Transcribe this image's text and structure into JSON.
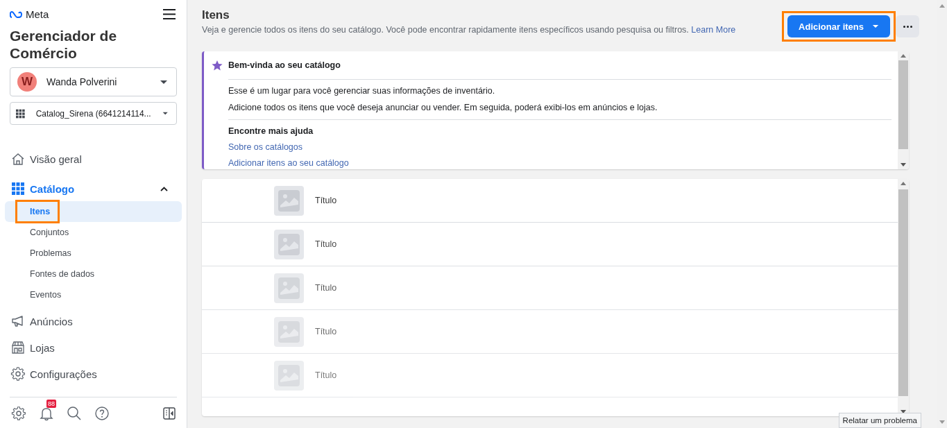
{
  "sidebar": {
    "brand": "Meta",
    "title": "Gerenciador de Comércio",
    "account": {
      "initial": "W",
      "name": "Wanda Polverini"
    },
    "catalog_selector": {
      "name": "Catalog_Sirena (6641214114..."
    },
    "nav": [
      {
        "kind": "main",
        "label": "Visão geral",
        "selected": false
      },
      {
        "kind": "group",
        "label": "Catálogo",
        "selected": true,
        "expanded": true,
        "children": [
          {
            "label": "Itens",
            "selected": true,
            "highlighted": true
          },
          {
            "label": "Conjuntos",
            "selected": false,
            "highlighted": false
          },
          {
            "label": "Problemas",
            "selected": false,
            "highlighted": false
          },
          {
            "label": "Fontes de dados",
            "selected": false,
            "highlighted": false
          },
          {
            "label": "Eventos",
            "selected": false,
            "highlighted": false
          }
        ]
      },
      {
        "kind": "main",
        "label": "Anúncios",
        "selected": false
      },
      {
        "kind": "main",
        "label": "Lojas",
        "selected": false
      },
      {
        "kind": "main",
        "label": "Configurações",
        "selected": false
      }
    ],
    "notification_badge": "88"
  },
  "header": {
    "title": "Itens",
    "description": "Veja e gerencie todos os itens do seu catálogo. Você pode encontrar rapidamente itens específicos usando pesquisa ou filtros.",
    "link": "Learn More",
    "add_button": {
      "label": "Adicionar itens",
      "highlighted": true
    }
  },
  "welcome_card": {
    "title": "Bem-vinda ao seu catálogo",
    "paragraphs": [
      "Esse é um lugar para você gerenciar suas informações de inventário.",
      "Adicione todos os itens que você deseja anunciar ou vender. Em seguida, poderá exibi-los em anúncios e lojas."
    ],
    "help_title": "Encontre mais ajuda",
    "links": [
      "Sobre os catálogos",
      "Adicionar itens ao seu catálogo"
    ]
  },
  "item_rows": [
    {
      "title": "Título"
    },
    {
      "title": "Título"
    },
    {
      "title": "Título"
    },
    {
      "title": "Título"
    },
    {
      "title": "Título"
    }
  ],
  "tooltip": "Relatar um problema"
}
